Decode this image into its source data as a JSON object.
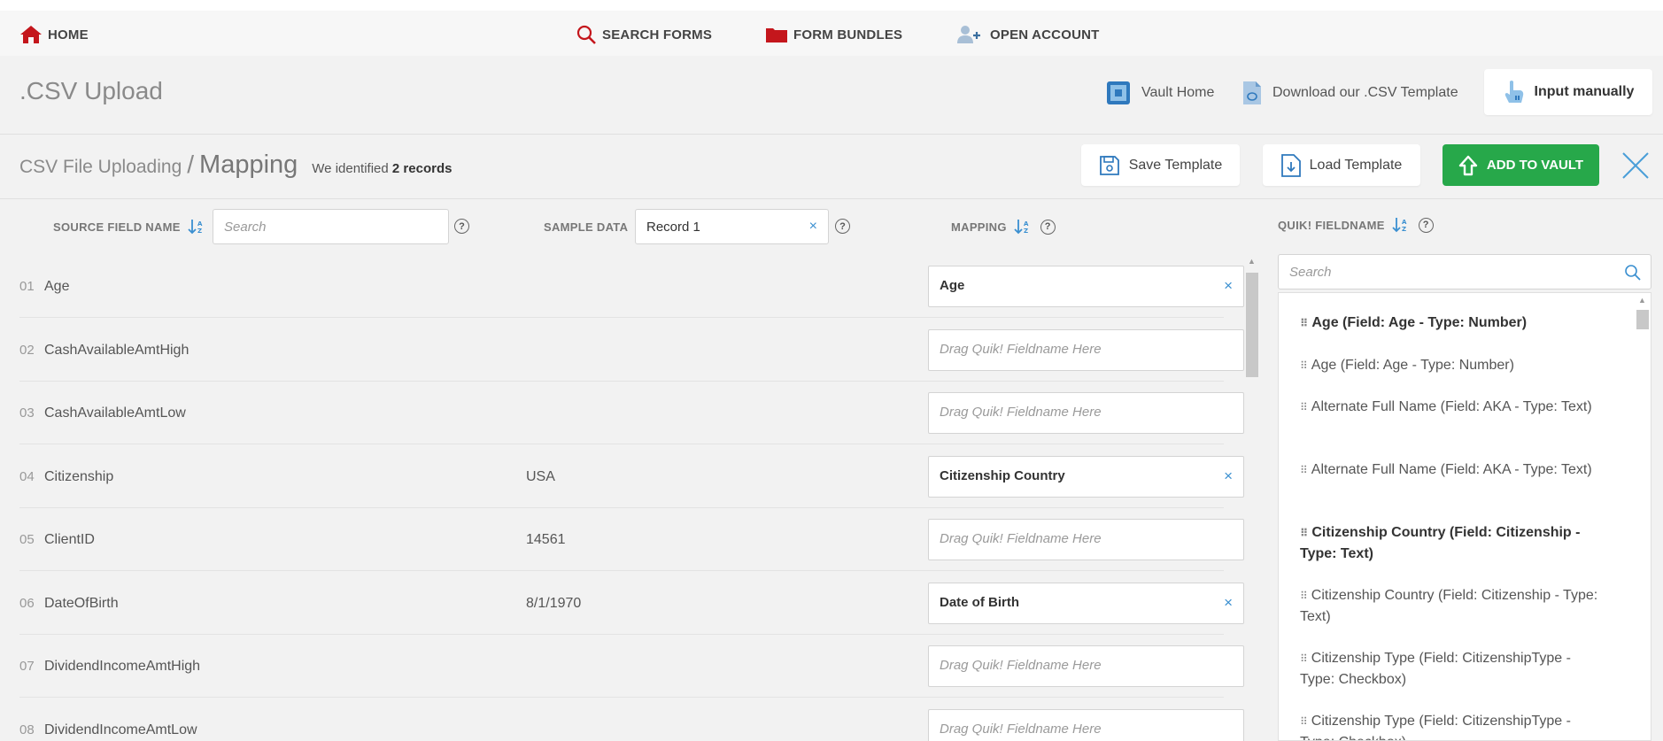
{
  "nav": {
    "home": "HOME",
    "search_forms": "SEARCH FORMS",
    "form_bundles": "FORM BUNDLES",
    "open_account": "OPEN ACCOUNT"
  },
  "header": {
    "title": ".CSV Upload",
    "vault_home": "Vault Home",
    "download_template": "Download our .CSV Template",
    "input_manually": "Input manually"
  },
  "mapbar": {
    "crumb_parent": "CSV File Uploading",
    "crumb_sep": "/",
    "crumb_current": "Mapping",
    "note_prefix": "We identified",
    "note_count": "2 records",
    "save_template": "Save Template",
    "load_template": "Load Template",
    "add_to_vault": "ADD TO VAULT"
  },
  "columns": {
    "source_field_name": "SOURCE FIELD NAME",
    "source_search_placeholder": "Search",
    "sample_data": "SAMPLE DATA",
    "sample_record": "Record 1",
    "mapping": "MAPPING",
    "quik_fieldname": "QUIK! FIELDNAME",
    "quik_search_placeholder": "Search",
    "help": "?",
    "clear": "×"
  },
  "rows": [
    {
      "index": "01",
      "field": "Age",
      "sample": "",
      "mapping": "Age",
      "placeholder": ""
    },
    {
      "index": "02",
      "field": "CashAvailableAmtHigh",
      "sample": "",
      "mapping": "",
      "placeholder": "Drag Quik! Fieldname Here"
    },
    {
      "index": "03",
      "field": "CashAvailableAmtLow",
      "sample": "",
      "mapping": "",
      "placeholder": "Drag Quik! Fieldname Here"
    },
    {
      "index": "04",
      "field": "Citizenship",
      "sample": "USA",
      "mapping": "Citizenship Country",
      "placeholder": ""
    },
    {
      "index": "05",
      "field": "ClientID",
      "sample": "14561",
      "mapping": "",
      "placeholder": "Drag Quik! Fieldname Here"
    },
    {
      "index": "06",
      "field": "DateOfBirth",
      "sample": "8/1/1970",
      "mapping": "Date of Birth",
      "placeholder": ""
    },
    {
      "index": "07",
      "field": "DividendIncomeAmtHigh",
      "sample": "",
      "mapping": "",
      "placeholder": "Drag Quik! Fieldname Here"
    },
    {
      "index": "08",
      "field": "DividendIncomeAmtLow",
      "sample": "",
      "mapping": "",
      "placeholder": "Drag Quik! Fieldname Here"
    }
  ],
  "quik_fields": [
    {
      "text": "Age (Field: Age - Type: Number)",
      "bold": true
    },
    {
      "text": "Age (Field: Age - Type: Number)",
      "bold": false
    },
    {
      "text": "Alternate Full Name (Field: AKA - Type: Text)",
      "bold": false
    },
    {
      "text": "Alternate Full Name (Field: AKA - Type: Text)",
      "bold": false
    },
    {
      "text": "Citizenship Country (Field: Citizenship - Type: Text)",
      "bold": true
    },
    {
      "text": "Citizenship Country (Field: Citizenship - Type: Text)",
      "bold": false
    },
    {
      "text": "Citizenship Type (Field: CitizenshipType - Type: Checkbox)",
      "bold": false
    },
    {
      "text": "Citizenship Type (Field: CitizenshipType - Type: Checkbox)",
      "bold": false
    }
  ],
  "colors": {
    "brand_red": "#c4161c",
    "accent_blue": "#3a8fd0",
    "add_green": "#27a84a"
  }
}
